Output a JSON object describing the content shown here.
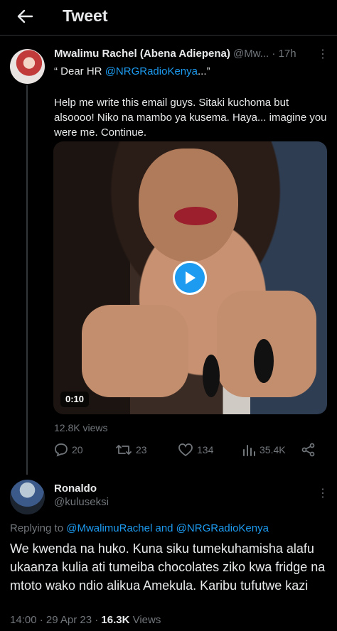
{
  "header": {
    "title": "Tweet",
    "back_icon": "back-arrow-icon"
  },
  "tweet": {
    "author_name": "Mwalimu Rachel (Abena Adiepena)",
    "handle": "@Mw...",
    "time": "· 17h",
    "line1_prefix": "“ Dear HR ",
    "line1_mention": "@NRGRadioKenya",
    "line1_suffix": "...”",
    "text": "Help me write this email guys. Sitaki kuchoma but alsoooo! Niko na mambo ya kusema. Haya... imagine you were me. Continue.",
    "video_duration": "0:10",
    "views": "12.8K views",
    "replies": "20",
    "retweets": "23",
    "likes": "134",
    "analytics": "35.4K"
  },
  "reply": {
    "author_name": "Ronaldo",
    "handle": "@kuluseksi",
    "replying_prefix": "Replying to ",
    "replying_to": "@MwalimuRachel and @NRGRadioKenya",
    "text": "We kwenda na huko. Kuna siku tumekuhamisha alafu ukaanza kulia ati tumeiba chocolates ziko kwa fridge na mtoto wako ndio alikua Amekula. Karibu tufutwe kazi",
    "timestamp": "14:00 · 29 Apr 23 · ",
    "views_count": "16.3K",
    "views_label": " Views"
  },
  "colors": {
    "accent": "#1d9bf0",
    "muted": "#71767b",
    "text": "#e7e9ea",
    "background": "#000000"
  }
}
